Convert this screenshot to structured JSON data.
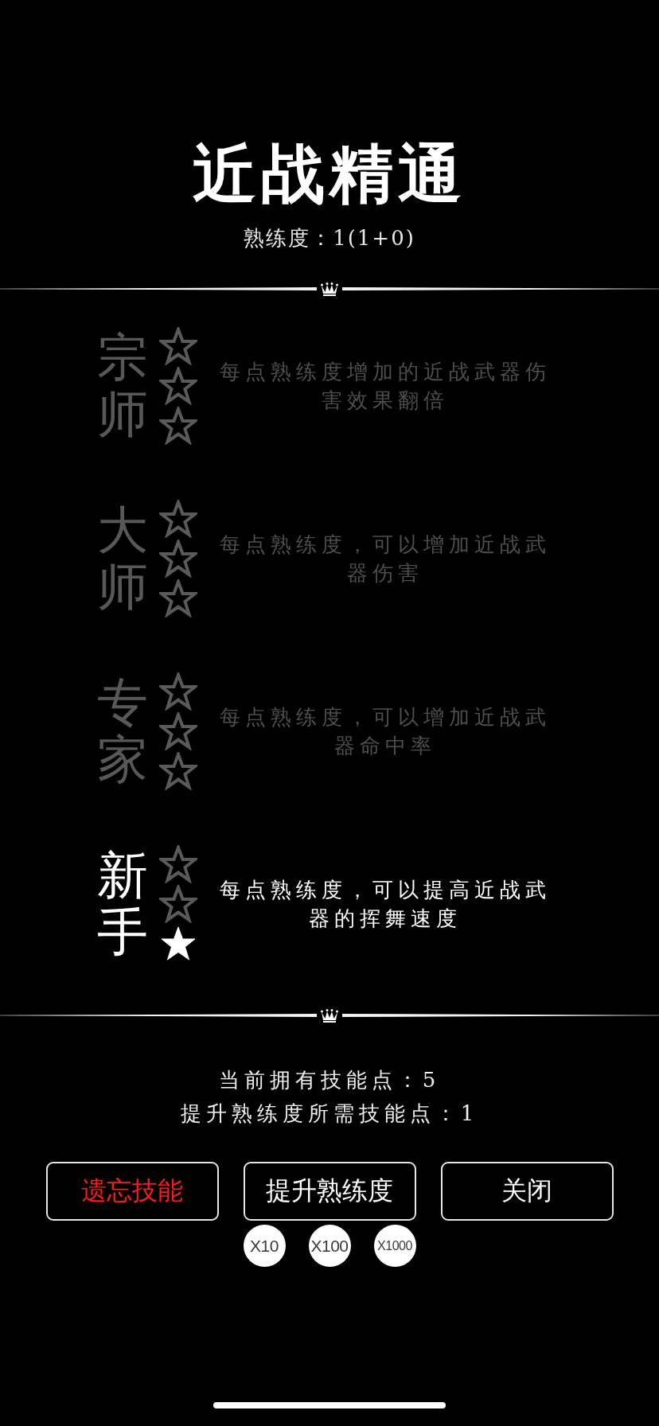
{
  "header": {
    "title": "近战精通",
    "proficiency": "熟练度：1(1+0)"
  },
  "tiers": [
    {
      "name": "宗师",
      "rank_stars": [
        {
          "filled": false
        },
        {
          "filled": false
        },
        {
          "filled": false
        }
      ],
      "disabled": true,
      "description": "每点熟练度增加的近战武器伤害效果翻倍"
    },
    {
      "name": "大师",
      "rank_stars": [
        {
          "filled": false
        },
        {
          "filled": false
        },
        {
          "filled": false
        }
      ],
      "disabled": true,
      "description": "每点熟练度，可以增加近战武器伤害"
    },
    {
      "name": "专家",
      "rank_stars": [
        {
          "filled": false
        },
        {
          "filled": false
        },
        {
          "filled": false
        }
      ],
      "disabled": true,
      "description": "每点熟练度，可以增加近战武器命中率"
    },
    {
      "name": "新手",
      "rank_stars": [
        {
          "filled": false
        },
        {
          "filled": false
        },
        {
          "filled": true
        }
      ],
      "disabled": false,
      "description": "每点熟练度，可以提高近战武器的挥舞速度"
    }
  ],
  "skill_points": {
    "owned": "当前拥有技能点：5",
    "required": "提升熟练度所需技能点：1"
  },
  "buttons": [
    {
      "label": "遗忘技能",
      "kind": "danger"
    },
    {
      "label": "提升熟练度",
      "kind": "default"
    },
    {
      "label": "关闭",
      "kind": "default"
    }
  ],
  "multipliers": [
    {
      "label": "X10"
    },
    {
      "label": "X100"
    },
    {
      "label": "X1000"
    }
  ]
}
